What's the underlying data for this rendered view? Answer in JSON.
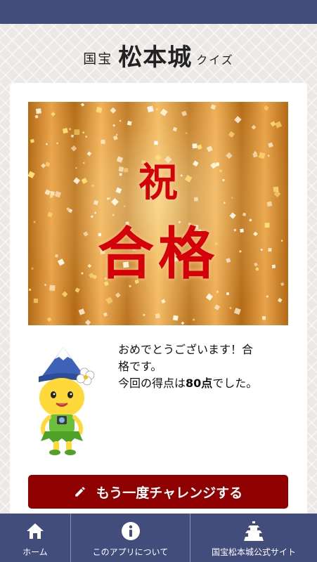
{
  "header": {
    "prefix": "国宝",
    "title": "松本城",
    "suffix": "クイズ"
  },
  "banner": {
    "line1": "祝",
    "line2": "合格"
  },
  "result": {
    "line1": "おめでとうございます！合",
    "line2": "格です。",
    "score_pre": "今回の得点は",
    "score": "80点",
    "score_post": "でした。"
  },
  "cta": {
    "label": "もう一度チャレンジする",
    "icon": "pencil-icon"
  },
  "tabs": [
    {
      "label": "ホーム",
      "icon": "home-icon"
    },
    {
      "label": "このアプリについて",
      "icon": "info-icon"
    },
    {
      "label": "国宝松本城公式サイト",
      "icon": "castle-icon"
    }
  ],
  "colors": {
    "nav": "#434d7c",
    "cta": "#8f0000",
    "kanji": "#d6000b"
  }
}
